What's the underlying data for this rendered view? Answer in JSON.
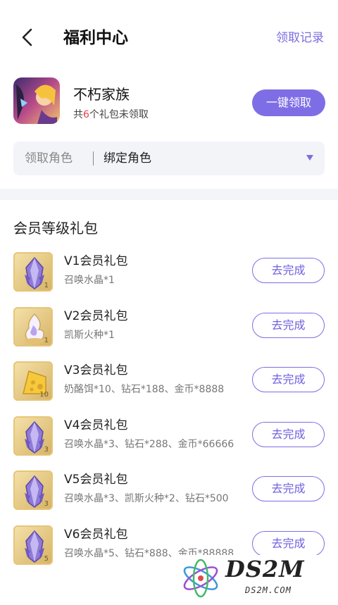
{
  "header": {
    "title": "福利中心",
    "records_label": "领取记录"
  },
  "game": {
    "name": "不朽家族",
    "unclaimed_prefix": "共",
    "unclaimed_count": "6",
    "unclaimed_suffix": "个礼包未领取",
    "claim_all_label": "一键领取"
  },
  "role_select": {
    "label": "领取角色",
    "value": "绑定角色"
  },
  "section": {
    "title": "会员等级礼包"
  },
  "packages": [
    {
      "name": "V1会员礼包",
      "items": "召唤水晶*1",
      "qty": "1",
      "icon": "crystal-icon",
      "button": "去完成"
    },
    {
      "name": "V2会员礼包",
      "items": "凯斯火种*1",
      "qty": "1",
      "icon": "flame-seed-icon",
      "button": "去完成"
    },
    {
      "name": "V3会员礼包",
      "items": "奶酪饵*10、钻石*188、金币*8888",
      "qty": "10",
      "icon": "cheese-icon",
      "button": "去完成"
    },
    {
      "name": "V4会员礼包",
      "items": "召唤水晶*3、钻石*288、金币*66666",
      "qty": "3",
      "icon": "crystal-icon",
      "button": "去完成"
    },
    {
      "name": "V5会员礼包",
      "items": "召唤水晶*3、凯斯火种*2、钻石*500",
      "qty": "3",
      "icon": "crystal-icon",
      "button": "去完成"
    },
    {
      "name": "V6会员礼包",
      "items": "召唤水晶*5、钻石*888、金币*88888",
      "qty": "5",
      "icon": "crystal-icon",
      "button": "去完成"
    }
  ],
  "watermark": {
    "text": "DS2M",
    "sub": "DS2M.COM"
  },
  "colors": {
    "accent": "#7e6ee6",
    "highlight": "#e8434c"
  }
}
